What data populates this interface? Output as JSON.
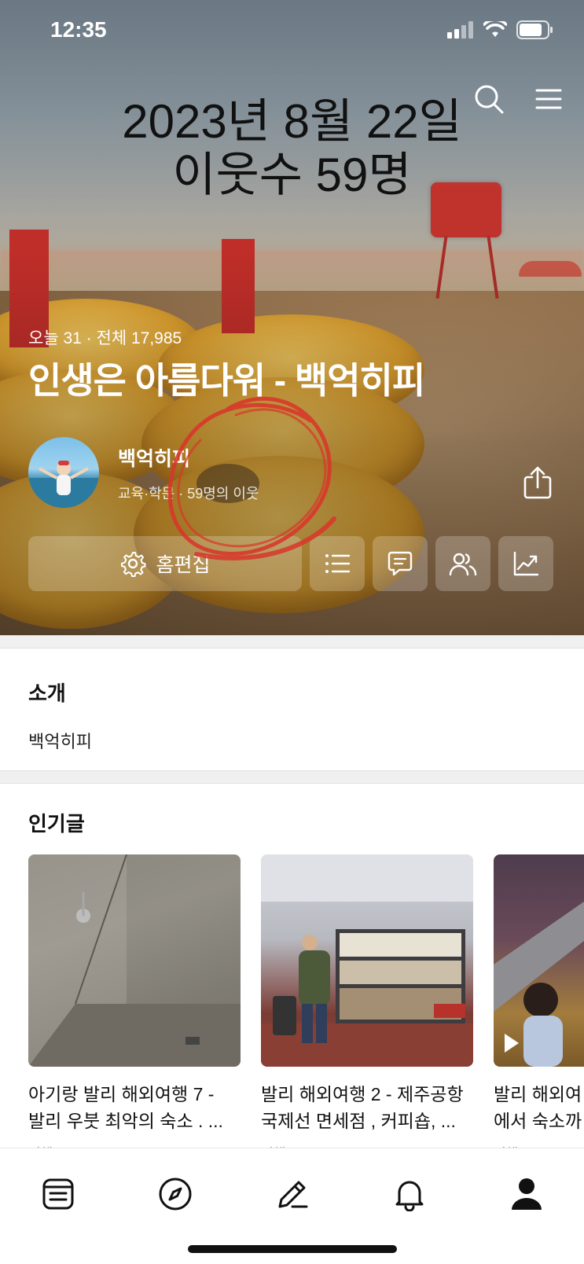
{
  "status_bar": {
    "time": "12:35"
  },
  "overlay": {
    "line1": "2023년 8월 22일",
    "line2": "이웃수 59명"
  },
  "blog": {
    "stats": "오늘 31  ·  전체 17,985",
    "title": "인생은 아름다워 - 백억히피",
    "author_name": "백억히피",
    "author_meta": "교육·학문 · 59명의 이웃"
  },
  "actions": {
    "home_edit_label": "홈편집"
  },
  "intro": {
    "title": "소개",
    "text": "백억히피"
  },
  "popular": {
    "title": "인기글",
    "posts": [
      {
        "title_line1": "아기랑 발리 해외여행 7 -",
        "title_line2": "발리 우붓 최악의 숙소 . ...",
        "category": "여행"
      },
      {
        "title_line1": "발리 해외여행 2 - 제주공항",
        "title_line2": "국제선 면세점 , 커피숍, ...",
        "category": "여행"
      },
      {
        "title_line1": "발리 해외여",
        "title_line2": "에서 숙소까",
        "category": "여행"
      }
    ]
  },
  "tab_bar": {
    "items": [
      {
        "icon": "feed-icon"
      },
      {
        "icon": "compass-icon"
      },
      {
        "icon": "pencil-icon"
      },
      {
        "icon": "bell-icon"
      },
      {
        "icon": "profile-icon"
      }
    ]
  },
  "colors": {
    "annotation_red": "#d8362a",
    "active_tab": "#111111"
  }
}
